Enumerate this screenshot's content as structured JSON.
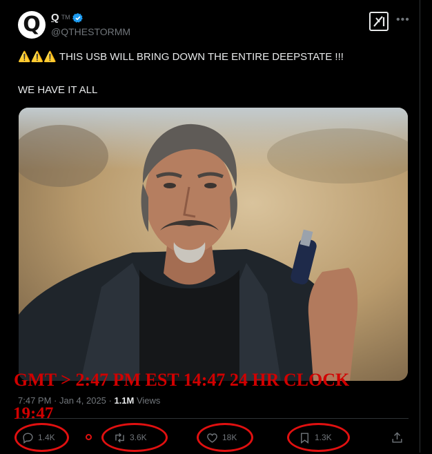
{
  "post": {
    "author": {
      "name": "Q",
      "tm": "TM",
      "handle": "@QTHESTORMM",
      "avatar_letter": "Q",
      "verified": true,
      "verified_color": "#1d9bf0"
    },
    "text_line1": "⚠️⚠️⚠️ THIS USB WILL BRING DOWN THE ENTIRE DEEPSTATE !!!",
    "text_line2": "WE HAVE IT ALL",
    "timestamp": "7:47 PM · Jan 4, 2025 · ",
    "views_count": "1.1M",
    "views_label": " Views"
  },
  "annotations": {
    "line1": "GMT > 2:47 PM EST 14:47 24 HR CLOCK",
    "line2": "19:47",
    "color": "#d10000"
  },
  "actions": {
    "replies": "1.4K",
    "reposts": "3.6K",
    "likes": "18K",
    "bookmarks": "1.3K"
  },
  "icons": [
    "grok-icon",
    "more-icon",
    "reply-icon",
    "repost-icon",
    "like-icon",
    "bookmark-icon",
    "share-icon"
  ]
}
